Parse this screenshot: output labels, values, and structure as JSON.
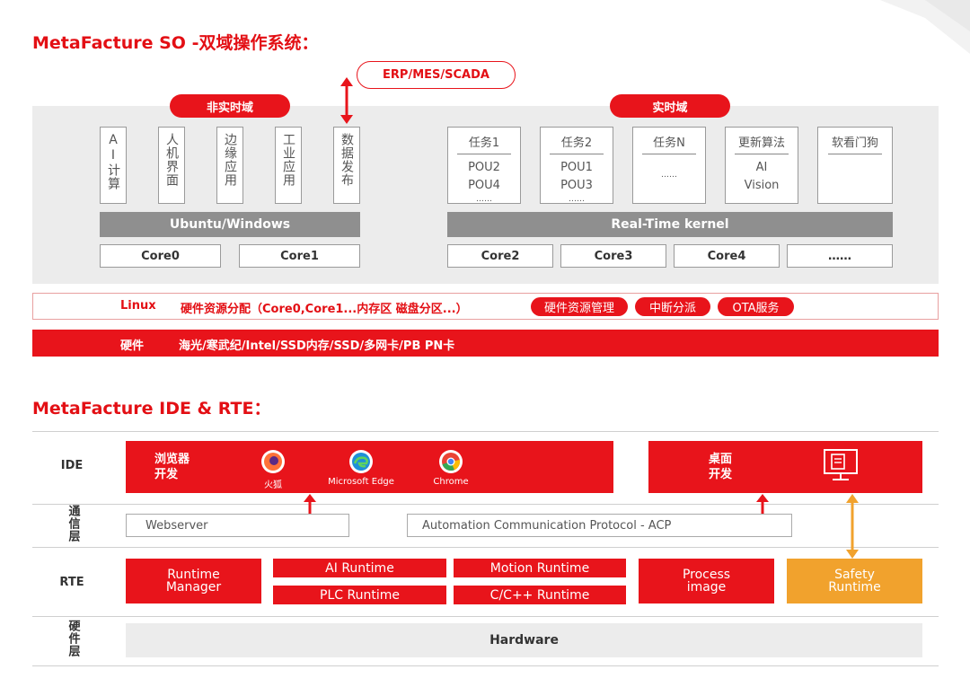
{
  "section1": {
    "title": "MetaFacture SO -双域操作系统：",
    "erp_label": "ERP/MES/SCADA",
    "non_rt_pill": "非实时域",
    "rt_pill": "实时域",
    "non_rt_apps": [
      "AI计算",
      "人机界面",
      "边缘应用",
      "工业应用",
      "数据发布"
    ],
    "rt_tasks": [
      {
        "title": "任务1",
        "lines": [
          "POU2",
          "POU4",
          "……"
        ]
      },
      {
        "title": "任务2",
        "lines": [
          "POU1",
          "POU3",
          "……"
        ]
      },
      {
        "title": "任务N",
        "lines": [
          "……"
        ]
      },
      {
        "title": "更新算法",
        "lines": [
          "AI",
          "Vision"
        ]
      },
      {
        "title": "软看门狗",
        "lines": []
      }
    ],
    "ubuntu_bar": "Ubuntu/Windows",
    "rt_kernel_bar": "Real-Time kernel",
    "cores": [
      "Core0",
      "Core1",
      "Core2",
      "Core3",
      "Core4",
      "……"
    ],
    "linux_label": "Linux",
    "linux_text": "硬件资源分配（Core0,Core1...内存区 磁盘分区...）",
    "linux_services": [
      "硬件资源管理",
      "中断分派",
      "OTA服务"
    ],
    "hw_label": "硬件",
    "hw_text": "海光/寒武纪/Intel/SSD内存/SSD/多网卡/PB PN卡"
  },
  "section2": {
    "title": "MetaFacture IDE & RTE：",
    "row_labels": {
      "ide": "IDE",
      "comm": "通信层",
      "rte": "RTE",
      "hw": "硬件层"
    },
    "browser_dev": "浏览器开发",
    "browsers": [
      {
        "name": "火狐",
        "icon": "firefox-icon",
        "color": "#ff7139"
      },
      {
        "name": "Microsoft Edge",
        "icon": "edge-icon",
        "color": "#1f8fd8"
      },
      {
        "name": "Chrome",
        "icon": "chrome-icon",
        "color": "#34a853"
      }
    ],
    "desktop_dev": "桌面开发",
    "webserver": "Webserver",
    "acp": "Automation Communication Protocol - ACP",
    "runtime_manager": "Runtime Manager",
    "ai_runtime": "AI Runtime",
    "motion_runtime": "Motion Runtime",
    "plc_runtime": "PLC Runtime",
    "cpp_runtime": "C/C++ Runtime",
    "process_image": "Process image",
    "safety_runtime": "Safety Runtime",
    "hardware": "Hardware"
  },
  "colors": {
    "accent": "#e8141b",
    "safety": "#f1a22d",
    "panel": "#ececec",
    "grey_bar": "#8f8f8f"
  }
}
